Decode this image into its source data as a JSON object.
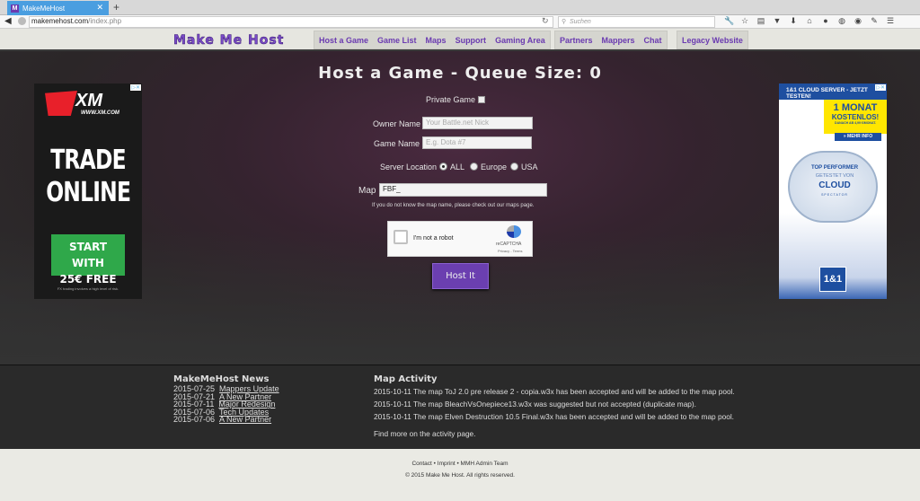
{
  "browser": {
    "tab_title": "MakeMeHost",
    "tab_favicon": "M",
    "url_domain": "makemehost.com",
    "url_path": "/index.php",
    "search_placeholder": "Suchen",
    "toolbar_icons": [
      "wrench-icon",
      "star-icon",
      "clipboard-icon",
      "pocket-icon",
      "download-icon",
      "home-icon",
      "chat-icon",
      "extension-icon",
      "color-icon",
      "pen-icon",
      "menu-icon"
    ]
  },
  "site": {
    "logo": "Make Me Host",
    "nav_primary": [
      {
        "label": "Host a Game"
      },
      {
        "label": "Game List"
      },
      {
        "label": "Maps"
      },
      {
        "label": "Support"
      },
      {
        "label": "Gaming Area"
      }
    ],
    "nav_secondary": [
      {
        "label": "Partners"
      },
      {
        "label": "Mappers"
      },
      {
        "label": "Chat"
      }
    ],
    "nav_legacy": {
      "label": "Legacy Website"
    },
    "accent_color": "#6b3fb0"
  },
  "form": {
    "title": "Host a Game - Queue Size: 0",
    "private_label": "Private Game",
    "private_checked": false,
    "owner_label": "Owner Name",
    "owner_placeholder": "Your Battle.net Nick",
    "game_label": "Game Name",
    "game_placeholder": "E.g. Dota #7",
    "server_label": "Server Location",
    "server_options": [
      {
        "label": "ALL",
        "selected": true
      },
      {
        "label": "Europe",
        "selected": false
      },
      {
        "label": "USA",
        "selected": false
      }
    ],
    "map_label": "Map",
    "map_value": "FBF_",
    "hint_text": "If you do not know the map name, please check out our",
    "hint_link": "maps page",
    "hint_end": ".",
    "captcha_label": "I'm not a robot",
    "captcha_brand": "reCAPTCHA",
    "captcha_links": "Privacy - Terms",
    "submit_label": "Host It"
  },
  "ads": {
    "left": {
      "brand": "XM",
      "url": "WWW.XM.COM",
      "line1": "TRADE",
      "line2": "ONLINE",
      "cta1": "START WITH",
      "cta2": "25€ FREE",
      "fine": "FX trading involves a high level of risk."
    },
    "right": {
      "header": "1&1 CLOUD SERVER - JETZT TESTEN!",
      "offer1": "1 MONAT",
      "offer2": "KOSTENLOS!",
      "offer3": "DANACH AB 4,99 €/MONAT.",
      "more": "» MEHR INFO",
      "badge1": "TOP PERFORMER",
      "badge2": "GETESTET VON",
      "badge3": "CLOUD",
      "badge4": "SPECTATOR",
      "logo": "1&1"
    }
  },
  "news": {
    "title": "MakeMeHost News",
    "items": [
      {
        "date": "2015-07-25",
        "label": "Mappers Update"
      },
      {
        "date": "2015-07-21",
        "label": "A New Partner"
      },
      {
        "date": "2015-07-11",
        "label": "Major Redesign"
      },
      {
        "date": "2015-07-06",
        "label": "Tech Updates"
      },
      {
        "date": "2015-07-06",
        "label": "A New Partner"
      }
    ]
  },
  "activity": {
    "title": "Map Activity",
    "items": [
      "2015-10-11 The map ToJ 2.0 pre release 2 - copia.w3x has been accepted and will be added to the map pool.",
      "2015-10-11 The map BleachVsOnepiece13.w3x was suggested but not accepted (duplicate map).",
      "2015-10-11 The map Elven Destruction 10.5 Final.w3x has been accepted and will be added to the map pool."
    ],
    "more_prefix": "Find more on the",
    "more_link": "activity",
    "more_suffix": "page."
  },
  "footer": {
    "links": [
      "Contact",
      "Imprint",
      "MMH Admin Team"
    ],
    "separator": "•",
    "copyright": "© 2015 Make Me Host. All rights reserved."
  }
}
